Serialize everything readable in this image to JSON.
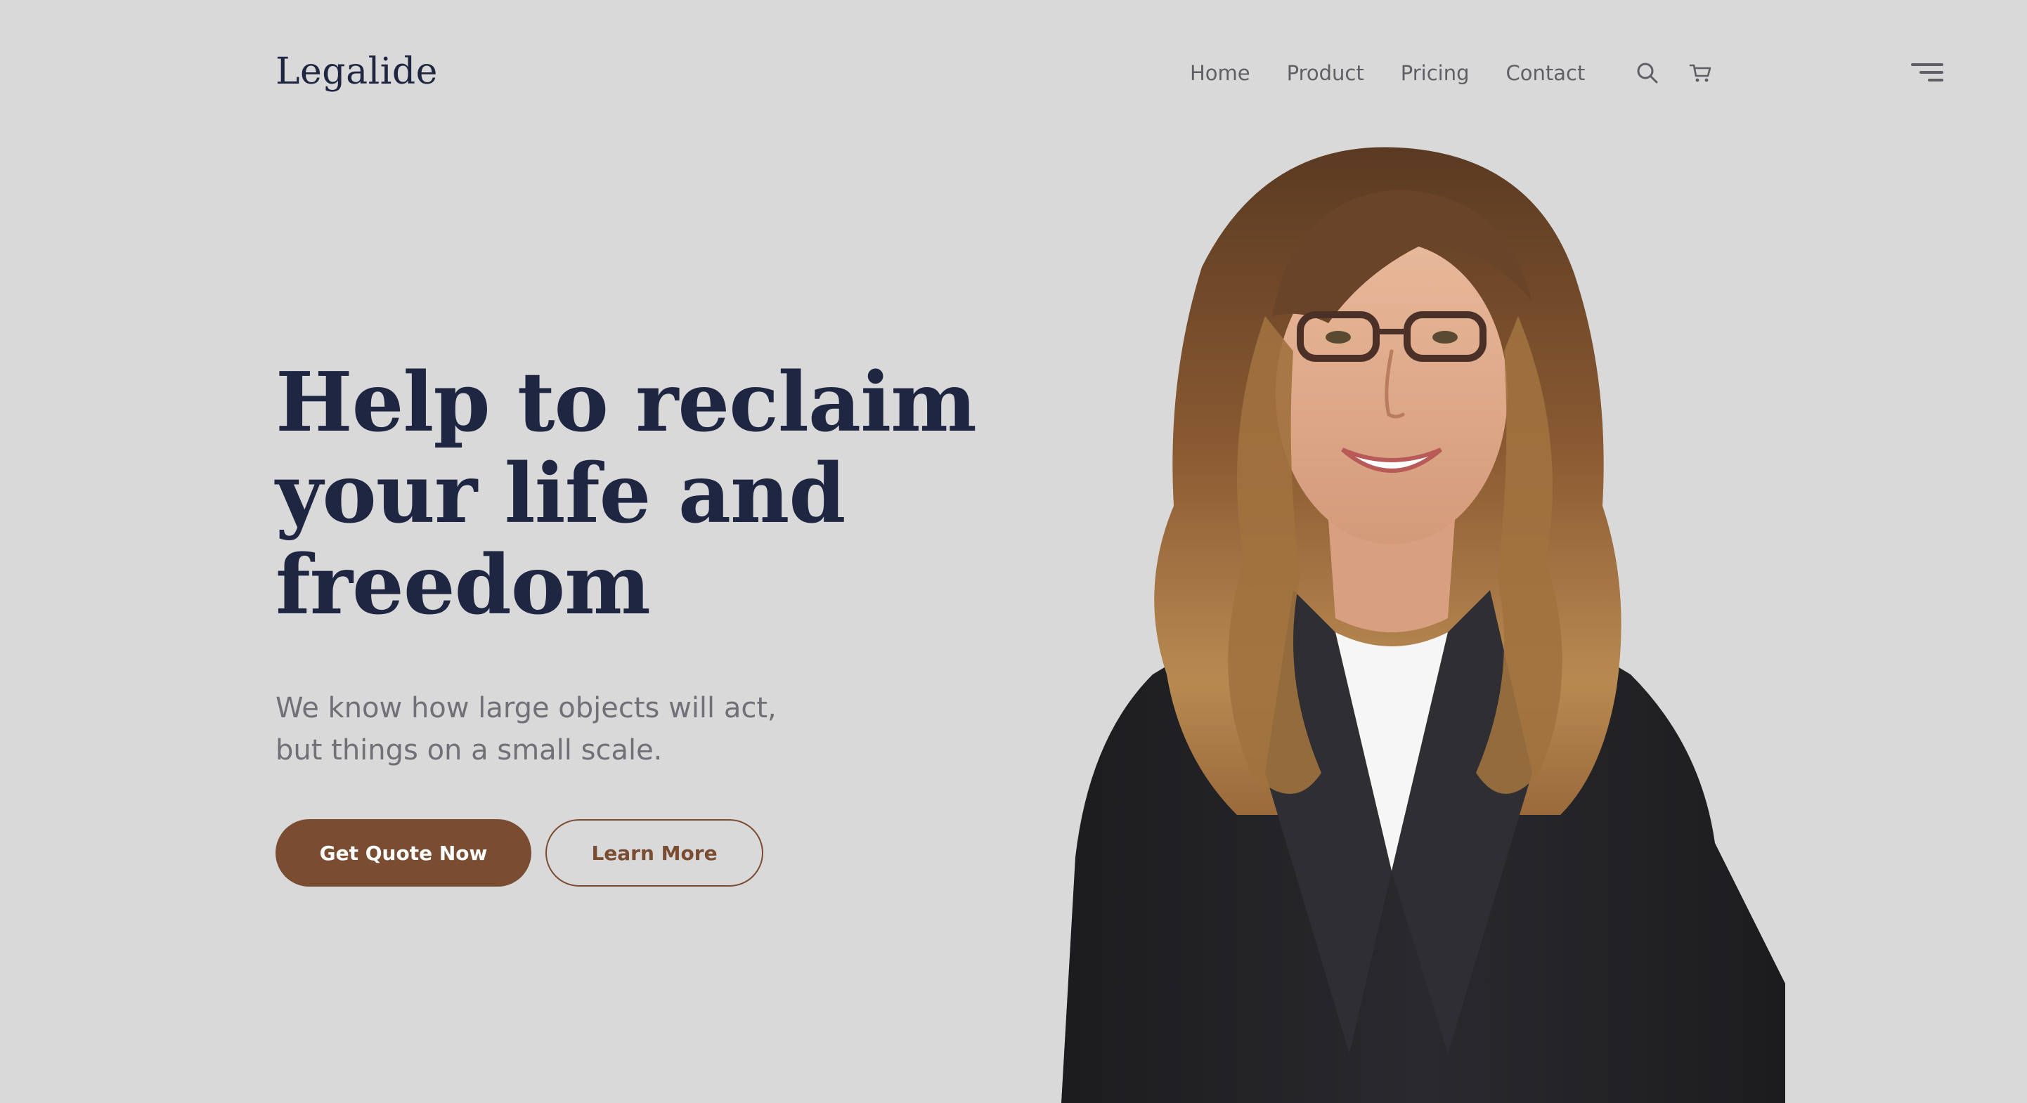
{
  "brand": {
    "name": "Legalide"
  },
  "nav": {
    "items": [
      "Home",
      "Product",
      "Pricing",
      "Contact"
    ]
  },
  "icons": {
    "search": "search-icon",
    "cart": "cart-icon",
    "menu": "menu-icon"
  },
  "hero": {
    "title_lines": [
      "Help to reclaim",
      "your life and",
      "freedom"
    ],
    "subtitle_lines": [
      "We know how large objects will act,",
      "but things on a small scale."
    ],
    "primary_button": "Get Quote Now",
    "secondary_button": "Learn More"
  },
  "colors": {
    "background": "#d9d9d9",
    "heading": "#1f2641",
    "accent": "#7a4d32",
    "nav_text": "#5f5f66",
    "subtitle": "#707078"
  }
}
